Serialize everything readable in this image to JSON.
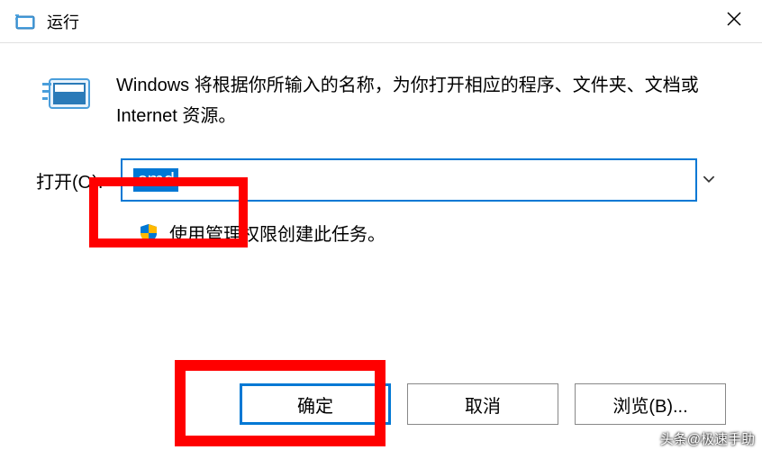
{
  "titlebar": {
    "title": "运行"
  },
  "description": "Windows 将根据你所输入的名称，为你打开相应的程序、文件夹、文档或 Internet 资源。",
  "input": {
    "label": "打开(O):",
    "value": "cmd"
  },
  "admin_note": "使用管理权限创建此任务。",
  "buttons": {
    "ok": "确定",
    "cancel": "取消",
    "browse": "浏览(B)..."
  },
  "watermark": "头条@极速手助"
}
